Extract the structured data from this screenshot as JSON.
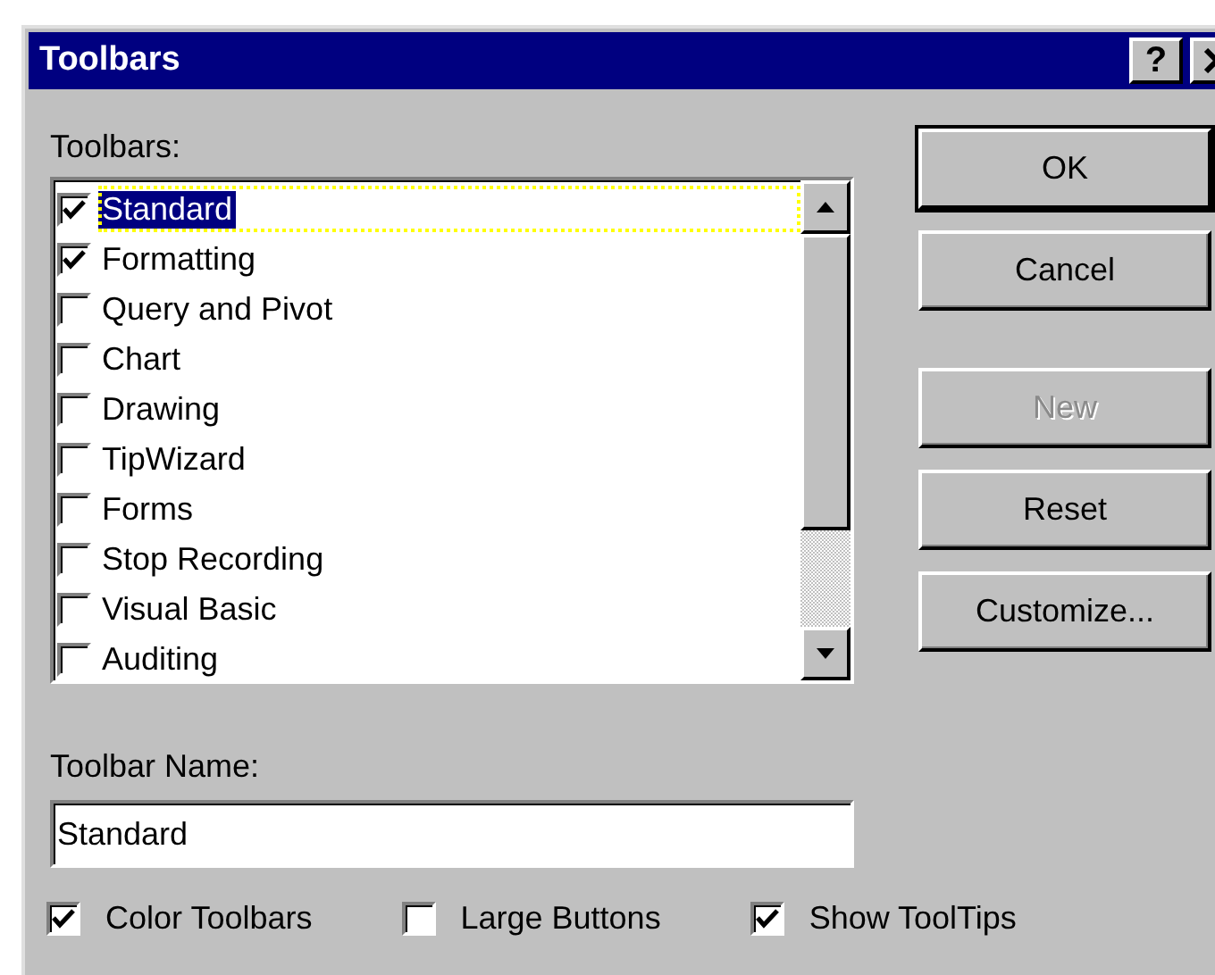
{
  "window": {
    "title": "Toolbars",
    "help_button": "?"
  },
  "toolbars_label": "Toolbars:",
  "toolbars": [
    {
      "label": "Standard",
      "checked": true,
      "selected": true
    },
    {
      "label": "Formatting",
      "checked": true,
      "selected": false
    },
    {
      "label": "Query and Pivot",
      "checked": false,
      "selected": false
    },
    {
      "label": "Chart",
      "checked": false,
      "selected": false
    },
    {
      "label": "Drawing",
      "checked": false,
      "selected": false
    },
    {
      "label": "TipWizard",
      "checked": false,
      "selected": false
    },
    {
      "label": "Forms",
      "checked": false,
      "selected": false
    },
    {
      "label": "Stop Recording",
      "checked": false,
      "selected": false
    },
    {
      "label": "Visual Basic",
      "checked": false,
      "selected": false
    },
    {
      "label": "Auditing",
      "checked": false,
      "selected": false
    }
  ],
  "buttons": [
    {
      "label": "OK",
      "default": true,
      "disabled": false
    },
    {
      "label": "Cancel",
      "default": false,
      "disabled": false
    },
    {
      "label": "New",
      "default": false,
      "disabled": true
    },
    {
      "label": "Reset",
      "default": false,
      "disabled": false
    },
    {
      "label": "Customize...",
      "default": false,
      "disabled": false
    }
  ],
  "toolbar_name": {
    "label": "Toolbar Name:",
    "value": "Standard"
  },
  "options": [
    {
      "label": "Color Toolbars",
      "checked": true
    },
    {
      "label": "Large Buttons",
      "checked": false
    },
    {
      "label": "Show ToolTips",
      "checked": true
    }
  ]
}
